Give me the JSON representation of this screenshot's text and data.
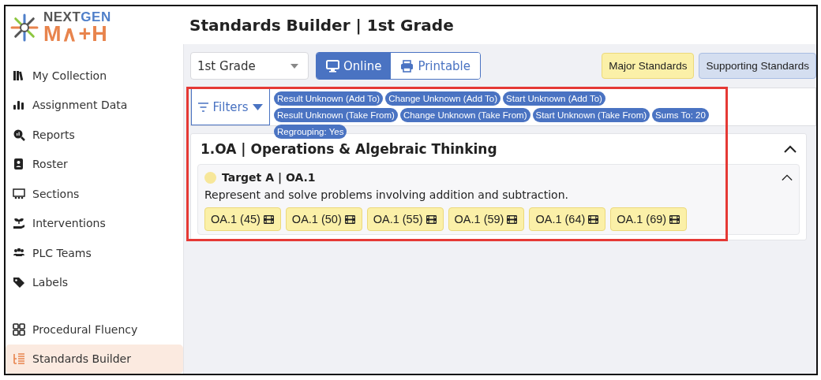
{
  "logo": {
    "line_1_part_1": "NEXT",
    "line_1_part_2": "GEN",
    "line_2": "M∧+H"
  },
  "sidebar": {
    "items": [
      {
        "label": "My Collection",
        "selected": false
      },
      {
        "label": "Assignment Data",
        "selected": false
      },
      {
        "label": "Reports",
        "selected": false
      },
      {
        "label": "Roster",
        "selected": false
      },
      {
        "label": "Sections",
        "selected": false
      },
      {
        "label": "Interventions",
        "selected": false
      },
      {
        "label": "PLC Teams",
        "selected": false
      },
      {
        "label": "Labels",
        "selected": false
      }
    ],
    "bottom_items": [
      {
        "label": "Procedural Fluency",
        "selected": false
      },
      {
        "label": "Standards Builder",
        "selected": true
      }
    ]
  },
  "page_title": "Standards Builder | 1st Grade",
  "grade_select": {
    "value": "1st Grade"
  },
  "view_toggle": [
    {
      "label": "Online",
      "selected": true
    },
    {
      "label": "Printable",
      "selected": false
    }
  ],
  "legend": [
    {
      "label": "Major Standards",
      "kind": "major"
    },
    {
      "label": "Supporting Standards",
      "kind": "supporting"
    }
  ],
  "filters": {
    "label": "Filters",
    "chips": [
      "Result Unknown (Add To)",
      "Change Unknown (Add To)",
      "Start Unknown (Add To)",
      "Result Unknown (Take From)",
      "Change Unknown (Take From)",
      "Start Unknown (Take From)",
      "Sums To: 20",
      "Regrouping: Yes"
    ]
  },
  "domain": {
    "title": "1.OA | Operations & Algebraic Thinking",
    "expanded": true,
    "targets": [
      {
        "title": "Target A | OA.1",
        "color": "#f7e79a",
        "expanded": true,
        "description": "Represent and solve problems involving addition and subtraction.",
        "resources": [
          {
            "label": "OA.1 (45)",
            "kind": "major"
          },
          {
            "label": "OA.1 (50)",
            "kind": "major"
          },
          {
            "label": "OA.1 (55)",
            "kind": "major"
          },
          {
            "label": "OA.1 (59)",
            "kind": "major"
          },
          {
            "label": "OA.1 (64)",
            "kind": "major"
          },
          {
            "label": "OA.1 (69)",
            "kind": "major"
          }
        ]
      }
    ]
  }
}
